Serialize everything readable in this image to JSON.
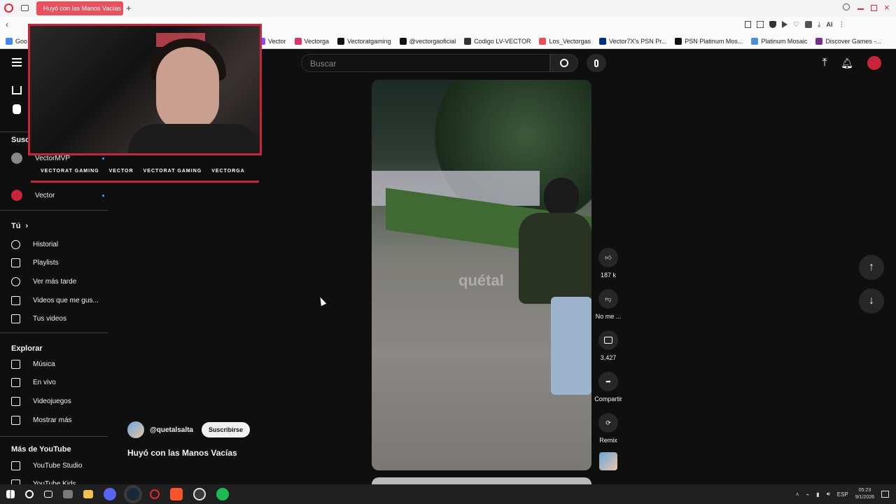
{
  "browser": {
    "tab_title": "Huyó con las Manos Vacías",
    "bookmarks": [
      {
        "label": "Goo",
        "color": "#4285f4"
      },
      {
        "label": "Vector",
        "color": "#9146ff"
      },
      {
        "label": "Vectorga",
        "color": "#e1306c"
      },
      {
        "label": "Vectoratgaming",
        "color": "#111111"
      },
      {
        "label": "@vectorgaoficial",
        "color": "#111111"
      },
      {
        "label": "Codigo LV-VECTOR",
        "color": "#333333"
      },
      {
        "label": "Los_Vectorgas",
        "color": "#e8505b"
      },
      {
        "label": "Vector7X's PSN Pr...",
        "color": "#003087"
      },
      {
        "label": "PSN Platinum Mos...",
        "color": "#111111"
      },
      {
        "label": "Platinum Mosaic",
        "color": "#4a90d9"
      },
      {
        "label": "Discover Games -...",
        "color": "#7b2d8e"
      }
    ]
  },
  "youtube": {
    "search_placeholder": "Buscar",
    "accent": "#ff0033",
    "sidebar": {
      "subs_head_partial": "Susc",
      "subscriptions": [
        {
          "label": "VectorMVP",
          "color": "#888888"
        },
        {
          "label": "Vector",
          "color": "#c8243a"
        }
      ],
      "you_head": "Tú",
      "you_items": [
        {
          "label": "Historial",
          "icon": "history-icon"
        },
        {
          "label": "Playlists",
          "icon": "playlists-icon"
        },
        {
          "label": "Ver más tarde",
          "icon": "watch-later-icon"
        },
        {
          "label": "Videos que me gus...",
          "icon": "liked-videos-icon"
        },
        {
          "label": "Tus videos",
          "icon": "your-videos-icon"
        }
      ],
      "explore_head": "Explorar",
      "explore_items": [
        {
          "label": "Música",
          "icon": "music-icon"
        },
        {
          "label": "En vivo",
          "icon": "live-icon"
        },
        {
          "label": "Videojuegos",
          "icon": "gaming-icon"
        },
        {
          "label": "Mostrar más",
          "icon": "chevron-down-icon"
        }
      ],
      "more_head": "Más de YouTube",
      "more_items": [
        {
          "label": "YouTube Studio",
          "icon": "youtube-studio-icon"
        },
        {
          "label": "YouTube Kids",
          "icon": "youtube-kids-icon"
        }
      ]
    },
    "short": {
      "channel": "@quetalsalta",
      "subscribe": "Suscribirse",
      "title": "Huyó con las Manos Vacías",
      "watermark": "quétal",
      "likes": "187 k",
      "dislike_label": "No me ...",
      "comments": "3,427",
      "share_label": "Compartir",
      "remix_label": "Remix"
    }
  },
  "overlay": {
    "socials": [
      "VECTORAT GAMING",
      "VECTOR",
      "VECTORAT GAMING",
      "VECTORGA"
    ]
  },
  "taskbar": {
    "lang": "ESP",
    "time": "05:23",
    "date": "9/1/2026"
  }
}
